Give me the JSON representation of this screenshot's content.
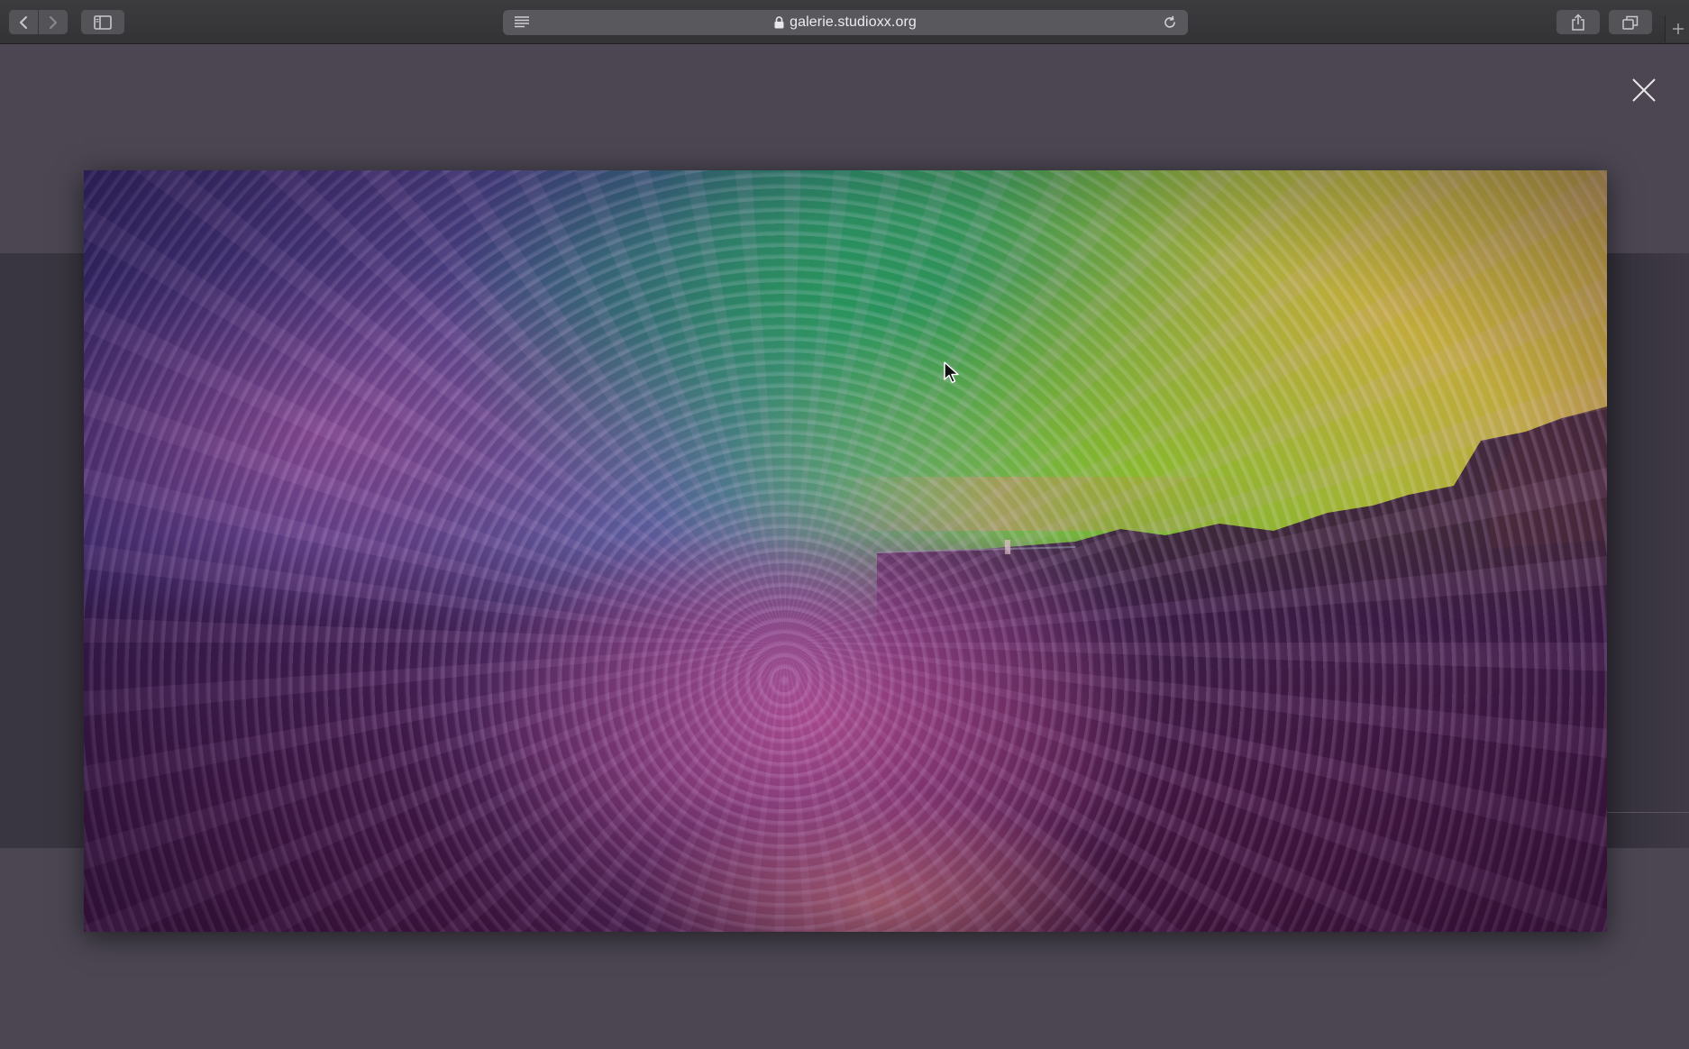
{
  "browser": {
    "url": "galerie.studioxx.org",
    "buttons": {
      "back": "back",
      "forward": "forward",
      "sidebar": "sidebar",
      "share": "share",
      "tabs": "tabs",
      "new_tab": "new-tab"
    },
    "icons": {
      "lock": "lock-icon",
      "reader": "reader-icon",
      "reload": "reload-icon"
    }
  },
  "lightbox": {
    "close_icon": "close-icon",
    "image": {
      "content": "swirling distorted coastal landscape in purple, green and yellow tones"
    }
  },
  "colors": {
    "toolbar_bg": "#38383b",
    "address_bar_bg": "#59595d",
    "overlay_bg": "#4b4652",
    "background_band": "#3a3641"
  }
}
